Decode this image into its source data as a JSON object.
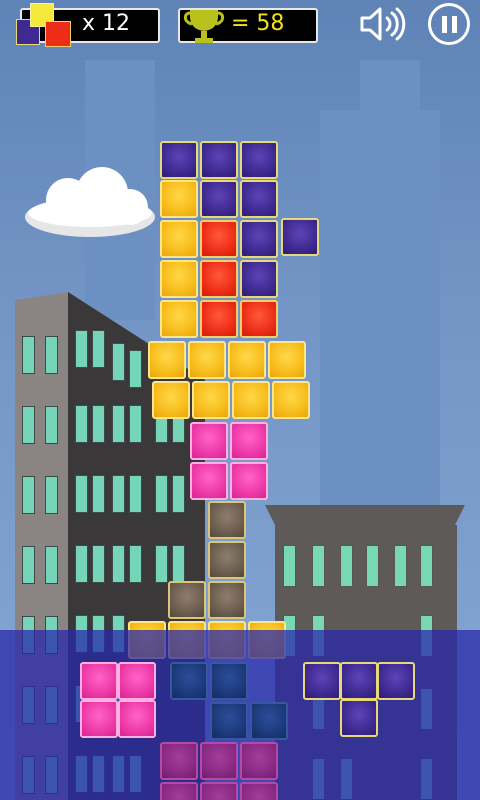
{
  "hud": {
    "blocks_left_label": "x 12",
    "score_label": "= 58"
  },
  "icons": {
    "blocks": "blocks-icon",
    "trophy": "trophy-icon",
    "sound": "speaker-icon",
    "pause": "pause-icon"
  },
  "colors": {
    "purple": "#3f2a92",
    "yellow": "#f7bd1c",
    "red": "#ee2d18",
    "pink": "#ee3aa9",
    "brown": "#6d5e50",
    "overlay": "#2828aa",
    "score_text": "#f2e21e"
  }
}
